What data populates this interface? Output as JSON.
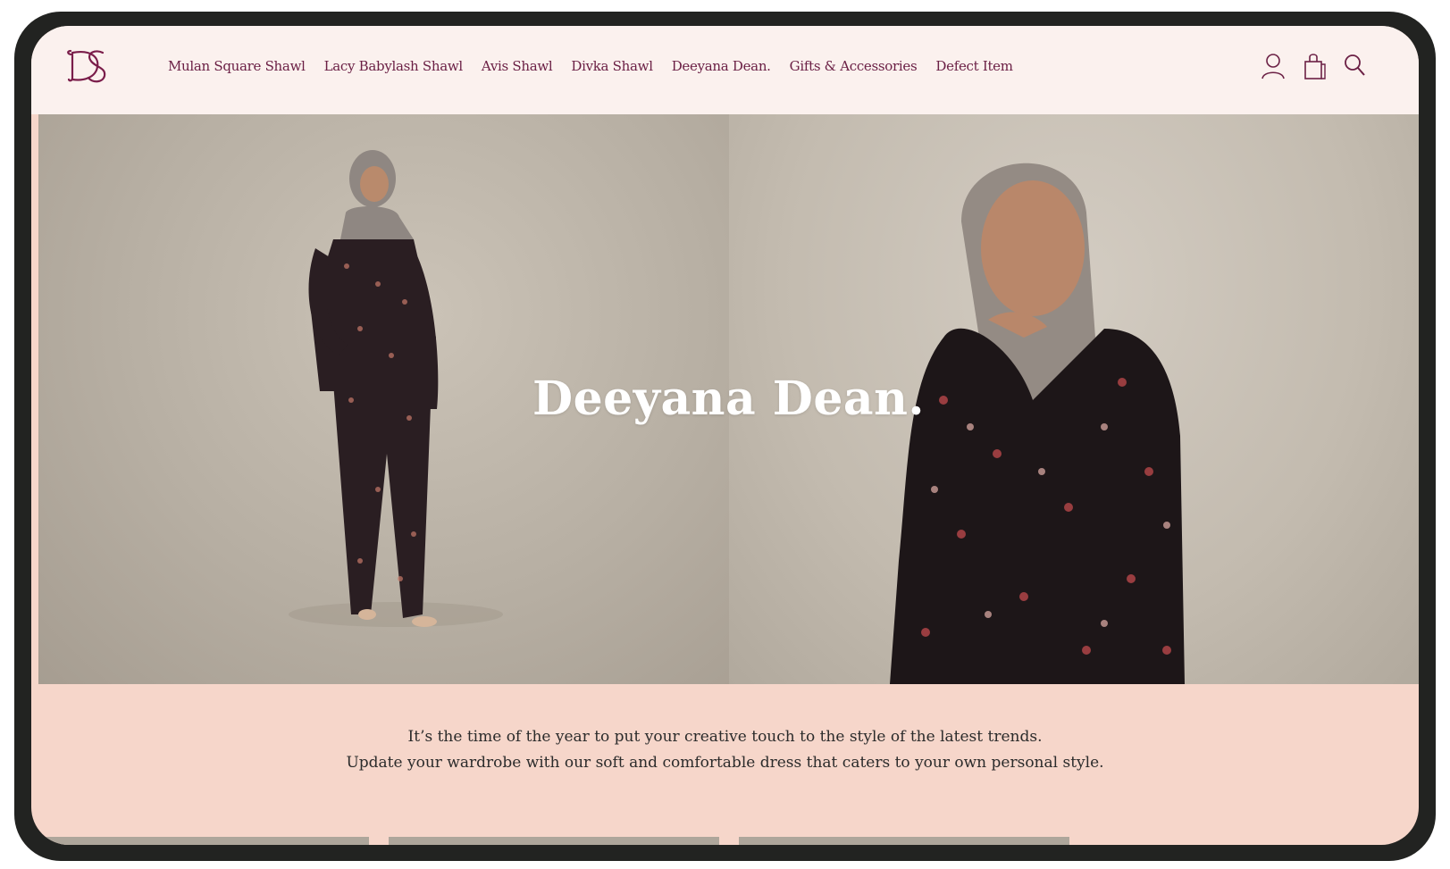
{
  "brand": {
    "logo_text": "DS",
    "logo_color": "#7a1d4a"
  },
  "nav": {
    "items": [
      "Mulan Square Shawl",
      "Lacy Babylash Shawl",
      "Avis Shawl",
      "Divka Shawl",
      "Deeyana Dean.",
      "Gifts & Accessories",
      "Defect Item"
    ]
  },
  "header_icons": [
    "account-icon",
    "shopping-bag-icon",
    "search-icon"
  ],
  "hero": {
    "title": "Deeyana Dean."
  },
  "intro": {
    "line1": "It’s the time of the year to put your creative touch to the style of the latest trends.",
    "line2": "Update your wardrobe with our soft and comfortable dress that caters to your own personal style."
  },
  "colors": {
    "accent": "#6b2045",
    "header_bg": "#fbf1ee",
    "page_bg": "#f6d6ca",
    "frame": "#222321"
  }
}
